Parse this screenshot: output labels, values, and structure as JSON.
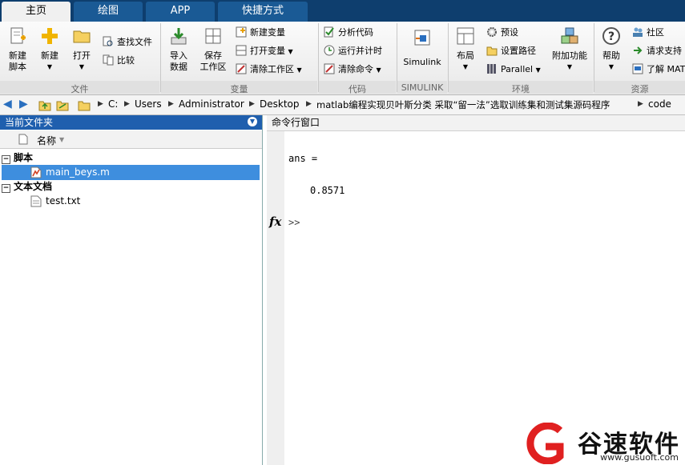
{
  "tabs": [
    {
      "label": "主页",
      "active": true
    },
    {
      "label": "绘图",
      "active": false
    },
    {
      "label": "APP",
      "active": false
    },
    {
      "label": "快捷方式",
      "active": false
    }
  ],
  "ribbon": {
    "file_group": {
      "label": "文件",
      "new_script": "新建\n脚本",
      "new": "新建",
      "open": "打开",
      "find_files": "查找文件",
      "compare": "比较"
    },
    "variable_group": {
      "label": "变量",
      "import_data": "导入\n数据",
      "save_workspace": "保存\n工作区",
      "new_variable": "新建变量",
      "open_variable": "打开变量",
      "clear_workspace": "清除工作区"
    },
    "code_group": {
      "label": "代码",
      "analyze_code": "分析代码",
      "run_and_time": "运行并计时",
      "clear_commands": "清除命令"
    },
    "simulink_group": {
      "label": "SIMULINK",
      "simulink": "Simulink"
    },
    "environment_group": {
      "label": "环境",
      "layout": "布局",
      "preferences": "预设",
      "set_path": "设置路径",
      "parallel": "Parallel",
      "addons": "附加功能"
    },
    "resources_group": {
      "label": "资源",
      "help": "帮助",
      "community": "社区",
      "request_support": "请求支持",
      "learn_matlab": "了解 MAT"
    }
  },
  "address": {
    "path": [
      "C:",
      "Users",
      "Administrator",
      "Desktop",
      "matlab编程实现贝叶斯分类 采取“留一法”选取训练集和测试集源码程序",
      "code"
    ]
  },
  "current_folder": {
    "title": "当前文件夹",
    "column_header": "名称",
    "sections": [
      {
        "label": "脚本",
        "files": [
          {
            "name": "main_beys.m",
            "selected": true
          }
        ]
      },
      {
        "label": "文本文档",
        "files": [
          {
            "name": "test.txt",
            "selected": false
          }
        ]
      }
    ]
  },
  "command_window": {
    "title": "命令行窗口",
    "lines": [
      "ans =",
      "0.8571"
    ],
    "prompt": ">>",
    "fx": "fx"
  },
  "watermark": {
    "brand": "谷速软件",
    "url": "www.gusuoft.com"
  },
  "colors": {
    "tab_bar": "#0e3e6e",
    "selection": "#3e8ede",
    "panel_title": "#1f5fae"
  }
}
